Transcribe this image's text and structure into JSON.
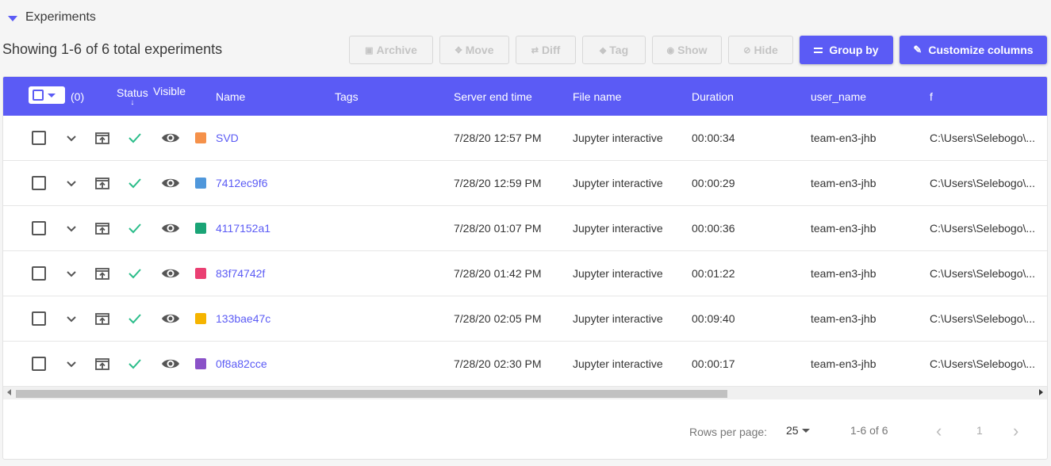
{
  "section": {
    "title": "Experiments"
  },
  "summary": "Showing 1-6 of 6 total experiments",
  "toolbar": {
    "archive": "Archive",
    "move": "Move",
    "diff": "Diff",
    "tag": "Tag",
    "show": "Show",
    "hide": "Hide",
    "group_by": "Group by",
    "customize": "Customize columns"
  },
  "table": {
    "select_count": "(0)",
    "headers": {
      "status": "Status",
      "visible": "Visible",
      "sort_arrow": "↓",
      "name": "Name",
      "tags": "Tags",
      "server_end_time": "Server end time",
      "file_name": "File name",
      "duration": "Duration",
      "user_name": "user_name",
      "f": "f"
    },
    "rows": [
      {
        "name": "SVD",
        "color": "#f5914a",
        "end_time": "7/28/20 12:57 PM",
        "file": "Jupyter interactive",
        "duration": "00:00:34",
        "user": "team-en3-jhb",
        "f": "C:\\Users\\Selebogo\\..."
      },
      {
        "name": "7412ec9f6",
        "color": "#4f97db",
        "end_time": "7/28/20 12:59 PM",
        "file": "Jupyter interactive",
        "duration": "00:00:29",
        "user": "team-en3-jhb",
        "f": "C:\\Users\\Selebogo\\..."
      },
      {
        "name": "4117152a1",
        "color": "#1aa476",
        "end_time": "7/28/20 01:07 PM",
        "file": "Jupyter interactive",
        "duration": "00:00:36",
        "user": "team-en3-jhb",
        "f": "C:\\Users\\Selebogo\\..."
      },
      {
        "name": "83f74742f",
        "color": "#ea3f72",
        "end_time": "7/28/20 01:42 PM",
        "file": "Jupyter interactive",
        "duration": "00:01:22",
        "user": "team-en3-jhb",
        "f": "C:\\Users\\Selebogo\\..."
      },
      {
        "name": "133bae47c",
        "color": "#f5b400",
        "end_time": "7/28/20 02:05 PM",
        "file": "Jupyter interactive",
        "duration": "00:09:40",
        "user": "team-en3-jhb",
        "f": "C:\\Users\\Selebogo\\..."
      },
      {
        "name": "0f8a82cce",
        "color": "#8a52c8",
        "end_time": "7/28/20 02:30 PM",
        "file": "Jupyter interactive",
        "duration": "00:00:17",
        "user": "team-en3-jhb",
        "f": "C:\\Users\\Selebogo\\..."
      }
    ]
  },
  "pagination": {
    "rows_per_page_label": "Rows per page:",
    "rows_per_page_value": "25",
    "range": "1-6 of 6",
    "page": "1"
  },
  "colors": {
    "accent": "#5b5bf5",
    "status_ok": "#2bbd8a"
  }
}
